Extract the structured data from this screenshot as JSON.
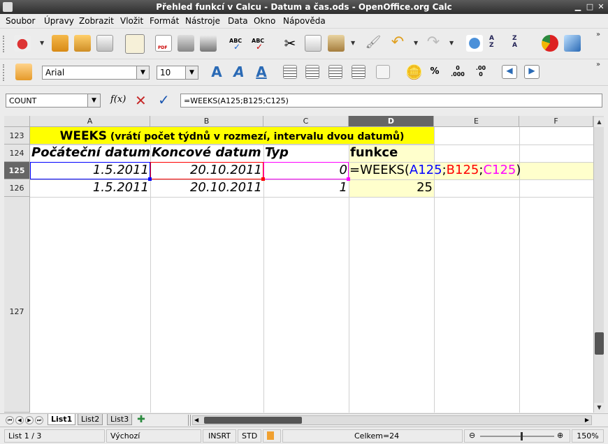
{
  "window": {
    "title": "Přehled funkcí v Calcu - Datum a čas.ods - OpenOffice.org Calc"
  },
  "menu": [
    "Soubor",
    "Úpravy",
    "Zobrazit",
    "Vložit",
    "Formát",
    "Nástroje",
    "Data",
    "Okno",
    "Nápověda"
  ],
  "format": {
    "font_name": "Arial",
    "font_size": "10"
  },
  "formula_bar": {
    "name_box": "COUNT",
    "fx_label": "f(x)",
    "formula": "=WEEKS(A125;B125;C125)"
  },
  "columns": [
    "A",
    "B",
    "C",
    "D",
    "E",
    "F"
  ],
  "rows": [
    "123",
    "124",
    "125",
    "126",
    "127"
  ],
  "cells": {
    "a123_bold": "WEEKS",
    "a123_rest": " (vrátí počet týdnů v rozmezí, intervalu dvou datumů)",
    "a124": "Počáteční datum",
    "b124": "Koncové datum",
    "c124": "Typ",
    "d124": "funkce",
    "a125": "1.5.2011",
    "b125": "20.10.2011",
    "c125": "0",
    "d125_func": "=WEEKS(",
    "d125_ref1": "A125",
    "d125_sep1": ";",
    "d125_ref2": "B125",
    "d125_sep2": ";",
    "d125_ref3": "C125",
    "d125_close": ")",
    "a126": "1.5.2011",
    "b126": "20.10.2011",
    "c126": "1",
    "d126": "25"
  },
  "colors": {
    "title_bg": "#ffff00",
    "d_col_bg": "#ffffcc",
    "ref_a": "#0000ff",
    "ref_b": "#ff0000",
    "ref_c": "#ff00ff"
  },
  "tabs": [
    "List1",
    "List2",
    "List3"
  ],
  "status": {
    "sheet": "List 1 / 3",
    "style": "Výchozí",
    "insert": "INSRT",
    "mode": "STD",
    "sum": "Celkem=24",
    "zoom": "150%"
  }
}
